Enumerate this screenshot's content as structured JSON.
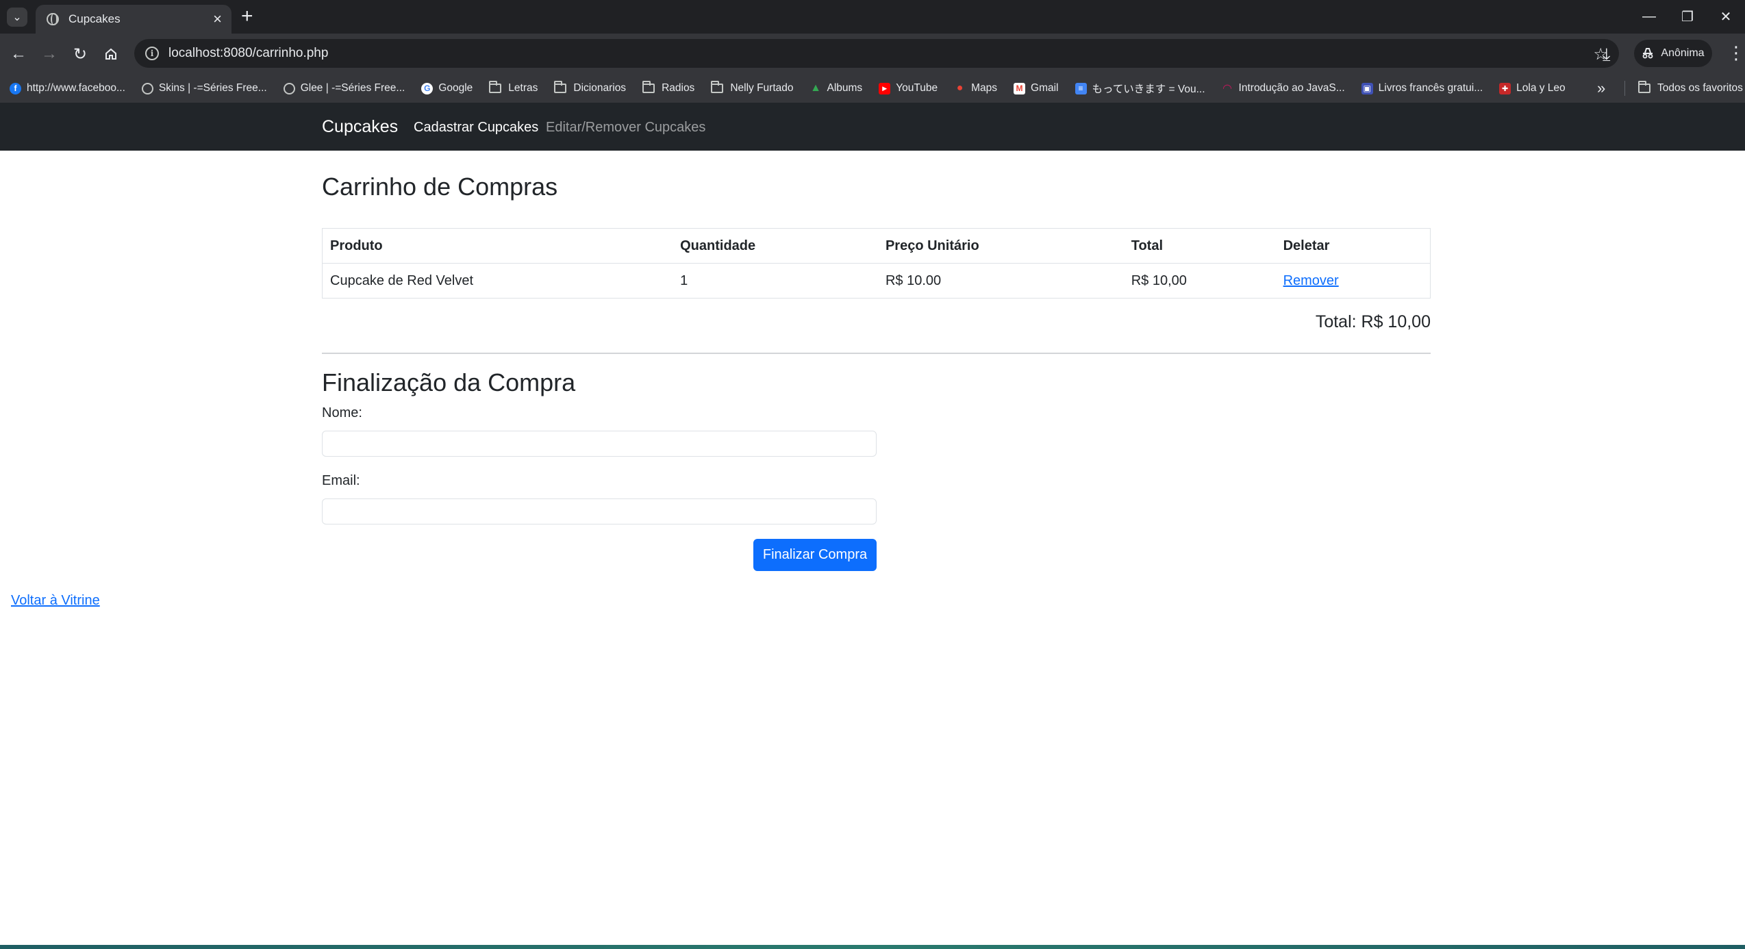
{
  "browser": {
    "tab_title": "Cupcakes",
    "url": "localhost:8080/carrinho.php",
    "profile_label": "Anônima",
    "bookmarks": [
      {
        "label": "http://www.faceboo...",
        "icon": "facebook-icon",
        "color": "#1877f2"
      },
      {
        "label": "Skins | -=Séries Free...",
        "icon": "globe-icon"
      },
      {
        "label": "Glee | -=Séries Free...",
        "icon": "globe-icon"
      },
      {
        "label": "Google",
        "icon": "google-icon",
        "color": "#4285f4"
      },
      {
        "label": "Letras",
        "icon": "folder-icon"
      },
      {
        "label": "Dicionarios",
        "icon": "folder-icon"
      },
      {
        "label": "Radios",
        "icon": "folder-icon"
      },
      {
        "label": "Nelly Furtado",
        "icon": "folder-icon"
      },
      {
        "label": "Albums",
        "icon": "google-drive-icon",
        "color": "#34a853"
      },
      {
        "label": "YouTube",
        "icon": "youtube-icon",
        "color": "#ff0000"
      },
      {
        "label": "Maps",
        "icon": "maps-icon",
        "color": "#ea4335"
      },
      {
        "label": "Gmail",
        "icon": "gmail-icon",
        "color": "#ea4335"
      },
      {
        "label": "もっていきます = Vou...",
        "icon": "docs-icon",
        "color": "#4285f4"
      },
      {
        "label": "Introdução ao JavaS...",
        "icon": "course-icon",
        "color": "#c2185b"
      },
      {
        "label": "Livros francês gratui...",
        "icon": "book-icon",
        "color": "#3f51b5"
      },
      {
        "label": "Lola y Leo",
        "icon": "uk-flag-icon",
        "color": "#c62828"
      }
    ],
    "all_bookmarks_label": "Todos os favoritos"
  },
  "navbar": {
    "brand": "Cupcakes",
    "links": [
      "Cadastrar Cupcakes",
      "Editar/Remover Cupcakes"
    ]
  },
  "cart": {
    "title": "Carrinho de Compras",
    "columns": [
      "Produto",
      "Quantidade",
      "Preço Unitário",
      "Total",
      "Deletar"
    ],
    "rows": [
      {
        "product": "Cupcake de Red Velvet",
        "quantity": "1",
        "unit_price": "R$ 10.00",
        "total": "R$ 10,00",
        "action": "Remover"
      }
    ],
    "grand_total": "Total: R$ 10,00"
  },
  "checkout": {
    "title": "Finalização da Compra",
    "name_label": "Nome:",
    "name_value": "",
    "email_label": "Email:",
    "email_value": "",
    "submit_label": "Finalizar Compra"
  },
  "back_link": "Voltar à Vitrine",
  "colors": {
    "navbar_bg": "#212529",
    "primary": "#0d6efd",
    "link": "#0d6efd"
  }
}
